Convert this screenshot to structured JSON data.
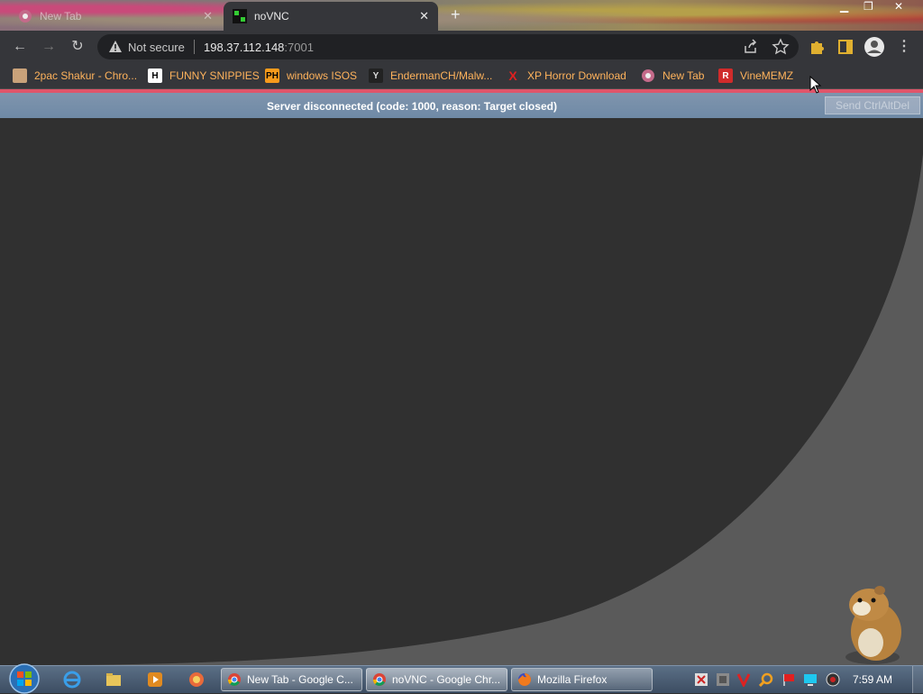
{
  "browser": {
    "tabs": [
      {
        "title": "New Tab",
        "active": false
      },
      {
        "title": "noVNC",
        "active": true
      }
    ],
    "address": {
      "security_label": "Not secure",
      "host": "198.37.112.148",
      "port": ":7001"
    },
    "bookmarks": [
      {
        "label": "2pac Shakur - Chro...",
        "icon": "store-icon"
      },
      {
        "label": "FUNNY SNIPPIES",
        "icon": "h-icon"
      },
      {
        "label": "windows ISOS",
        "icon": "ph-icon"
      },
      {
        "label": "EndermanCH/Malw...",
        "icon": "yt-icon"
      },
      {
        "label": "XP Horror Download",
        "icon": "x-icon"
      },
      {
        "label": "New Tab",
        "icon": "globe-icon"
      },
      {
        "label": "VineMEMZ",
        "icon": "r-icon"
      }
    ]
  },
  "vnc": {
    "status_message": "Server disconnected (code: 1000, reason: Target closed)",
    "send_cad_label": "Send CtrlAltDel"
  },
  "taskbar": {
    "tasks": [
      {
        "label": "New Tab - Google C...",
        "icon": "chrome-icon"
      },
      {
        "label": "noVNC - Google Chr...",
        "icon": "chrome-icon"
      },
      {
        "label": "Mozilla Firefox",
        "icon": "firefox-icon"
      }
    ],
    "clock": "7:59 AM"
  },
  "colors": {
    "bookmark_text": "#ffb35c",
    "status_bar": "#6f8aa6",
    "status_stripe": "#e0556a"
  }
}
